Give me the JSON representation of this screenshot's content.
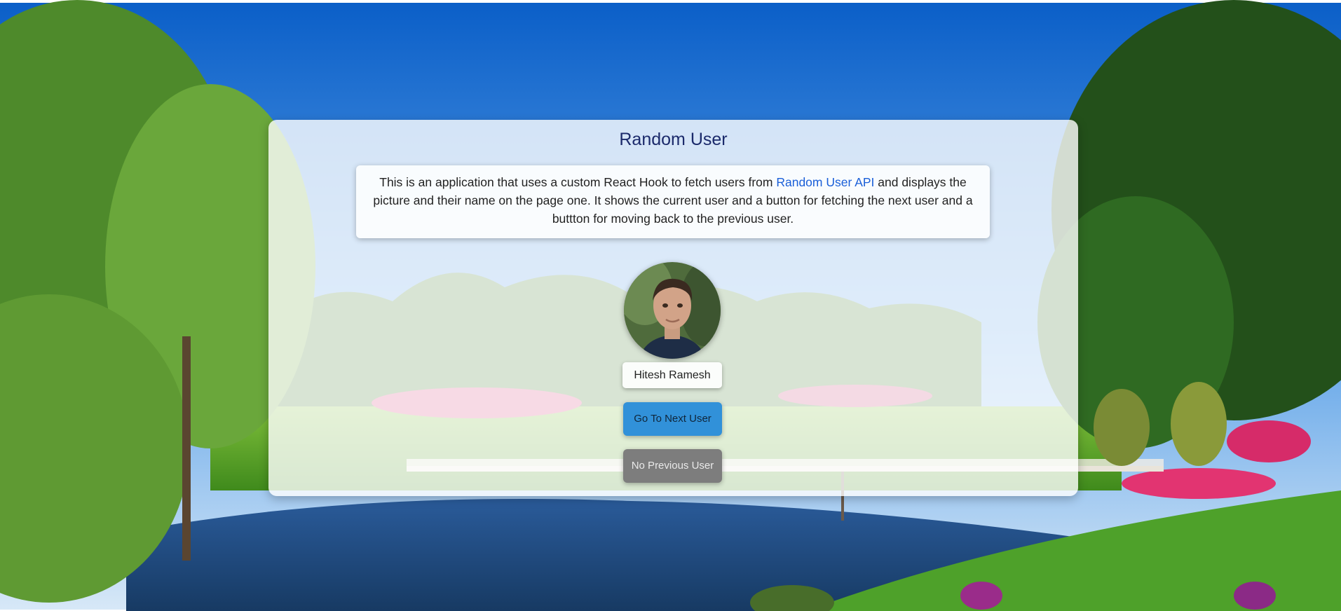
{
  "app": {
    "title": "Random User"
  },
  "description": {
    "text_before": "This is an application that uses a custom React Hook to fetch users from ",
    "link_text": "Random User API",
    "text_after": " and displays the picture and their name on the page one. It shows the current user and a button for fetching the next user and a buttton for moving back to the previous user."
  },
  "user": {
    "name": "Hitesh Ramesh"
  },
  "buttons": {
    "next_label": "Go To Next User",
    "prev_label": "No Previous User"
  },
  "colors": {
    "accent": "#3191d9",
    "title": "#1b2a6b",
    "link": "#1a5fd8",
    "disabled_button": "#7d7d7d"
  },
  "icons": {
    "avatar": "user-photo",
    "background": "landscape-photo"
  }
}
